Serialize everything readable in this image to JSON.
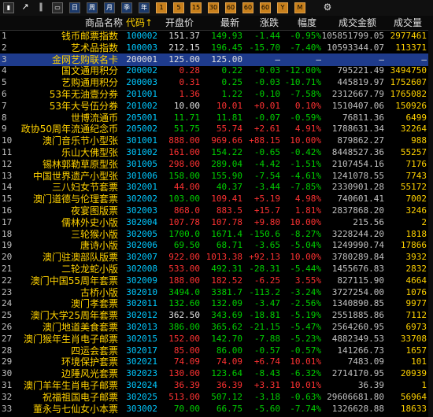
{
  "toolbar": {
    "buttons": [
      {
        "name": "bar-chart-icon",
        "label": "▮",
        "style": "square"
      },
      {
        "name": "line-chart-icon",
        "label": "↗",
        "style": "chart"
      },
      {
        "name": "tick-chart-icon",
        "label": "∥",
        "style": "chart"
      },
      {
        "name": "screen-icon",
        "label": "▭",
        "style": "square"
      },
      {
        "name": "period-day-button",
        "label": "日",
        "style": "blue"
      },
      {
        "name": "period-week-button",
        "label": "周",
        "style": "blue"
      },
      {
        "name": "period-month-button",
        "label": "月",
        "style": "blue"
      },
      {
        "name": "period-quarter-button",
        "label": "季",
        "style": "blue"
      },
      {
        "name": "period-year-button",
        "label": "年",
        "style": "blue"
      },
      {
        "name": "period-1min-button",
        "label": "1",
        "style": "orange"
      },
      {
        "name": "period-5min-button",
        "label": "5",
        "style": "orange"
      },
      {
        "name": "period-15min-button",
        "label": "15",
        "style": "orange"
      },
      {
        "name": "period-30min-button",
        "label": "30",
        "style": "orange"
      },
      {
        "name": "period-60min-button",
        "label": "60",
        "style": "orange"
      },
      {
        "name": "period-60min-button-2",
        "label": "60",
        "style": "orange"
      },
      {
        "name": "period-60min-button-3",
        "label": "60",
        "style": "orange"
      },
      {
        "name": "period-y-button",
        "label": "Y",
        "style": "orange"
      },
      {
        "name": "period-m-button",
        "label": "M",
        "style": "orange"
      },
      {
        "name": "settings-gear-icon",
        "label": "⚙",
        "style": "gear"
      }
    ]
  },
  "header": {
    "name": "商品名称",
    "code": "代码↑",
    "open": "开盘价",
    "last": "最新",
    "chg": "涨跌",
    "pct": "幅度",
    "amount": "成交金额",
    "volume": "成交量"
  },
  "rows": [
    {
      "idx": "1",
      "name": "钱币邮票指数",
      "code": "100002",
      "open": "151.37",
      "last": "149.93",
      "chg": "-1.44",
      "pct": "-0.95%",
      "amount": "105851799.05",
      "volume": "2977461",
      "openC": "white",
      "lastC": "green",
      "chgC": "green"
    },
    {
      "idx": "2",
      "name": "艺术品指数",
      "code": "100003",
      "open": "212.15",
      "last": "196.45",
      "chg": "-15.70",
      "pct": "-7.40%",
      "amount": "10593344.07",
      "volume": "113371",
      "openC": "white",
      "lastC": "green",
      "chgC": "green"
    },
    {
      "idx": "3",
      "name": "金网艺购联名卡",
      "code": "200001",
      "open": "125.00",
      "last": "125.00",
      "chg": "—",
      "pct": "—",
      "amount": "—",
      "volume": "—",
      "openC": "white",
      "lastC": "white",
      "chgC": "white",
      "selected": true
    },
    {
      "idx": "4",
      "name": "国文通用积分",
      "code": "200002",
      "open": "0.28",
      "last": "0.22",
      "chg": "-0.03",
      "pct": "-12.00%",
      "amount": "795221.49",
      "volume": "3494750",
      "openC": "red",
      "lastC": "green",
      "chgC": "green"
    },
    {
      "idx": "5",
      "name": "艺购通用积分",
      "code": "200003",
      "open": "0.31",
      "last": "0.25",
      "chg": "-0.03",
      "pct": "-10.71%",
      "amount": "445819.97",
      "volume": "1752607",
      "openC": "red",
      "lastC": "green",
      "chgC": "green"
    },
    {
      "idx": "6",
      "name": "53年无油壹分券",
      "code": "201001",
      "open": "1.36",
      "last": "1.22",
      "chg": "-0.10",
      "pct": "-7.58%",
      "amount": "2312667.79",
      "volume": "1765082",
      "openC": "red",
      "lastC": "green",
      "chgC": "green"
    },
    {
      "idx": "7",
      "name": "53年大号伍分券",
      "code": "201002",
      "open": "10.00",
      "last": "10.01",
      "chg": "+0.01",
      "pct": "0.10%",
      "amount": "1510407.06",
      "volume": "150926",
      "openC": "white",
      "lastC": "red",
      "chgC": "red"
    },
    {
      "idx": "8",
      "name": "世博流通币",
      "code": "205001",
      "open": "11.71",
      "last": "11.81",
      "chg": "-0.07",
      "pct": "-0.59%",
      "amount": "76811.36",
      "volume": "6499",
      "openC": "green",
      "lastC": "green",
      "chgC": "green"
    },
    {
      "idx": "9",
      "name": "政协50周年流通纪念币",
      "code": "205002",
      "open": "51.75",
      "last": "55.74",
      "chg": "+2.61",
      "pct": "4.91%",
      "amount": "1788631.34",
      "volume": "32264",
      "openC": "green",
      "lastC": "red",
      "chgC": "red"
    },
    {
      "idx": "10",
      "name": "澳门音乐节小型张",
      "code": "301001",
      "open": "888.00",
      "last": "969.66",
      "chg": "+88.15",
      "pct": "10.00%",
      "amount": "879862.27",
      "volume": "988",
      "openC": "red",
      "lastC": "red",
      "chgC": "red"
    },
    {
      "idx": "11",
      "name": "乐山大佛型张",
      "code": "301002",
      "open": "161.00",
      "last": "154.22",
      "chg": "-0.65",
      "pct": "-0.42%",
      "amount": "8448527.36",
      "volume": "55257",
      "openC": "red",
      "lastC": "green",
      "chgC": "green"
    },
    {
      "idx": "12",
      "name": "锡林郭勒草原型张",
      "code": "301005",
      "open": "298.00",
      "last": "289.04",
      "chg": "-4.42",
      "pct": "-1.51%",
      "amount": "2107454.16",
      "volume": "7176",
      "openC": "red",
      "lastC": "green",
      "chgC": "green"
    },
    {
      "idx": "13",
      "name": "中国世界遗产小型张",
      "code": "301006",
      "open": "158.00",
      "last": "155.90",
      "chg": "-7.54",
      "pct": "-4.61%",
      "amount": "1241078.55",
      "volume": "7743",
      "openC": "green",
      "lastC": "green",
      "chgC": "green"
    },
    {
      "idx": "14",
      "name": "三八妇女节套票",
      "code": "302001",
      "open": "44.00",
      "last": "40.37",
      "chg": "-3.44",
      "pct": "-7.85%",
      "amount": "2330901.28",
      "volume": "55172",
      "openC": "red",
      "lastC": "green",
      "chgC": "green"
    },
    {
      "idx": "15",
      "name": "澳门道德与伦理套票",
      "code": "302002",
      "open": "103.00",
      "last": "109.41",
      "chg": "+5.19",
      "pct": "4.98%",
      "amount": "740601.41",
      "volume": "7002",
      "openC": "green",
      "lastC": "red",
      "chgC": "red"
    },
    {
      "idx": "16",
      "name": "夜宴图版票",
      "code": "302003",
      "open": "868.0",
      "last": "883.5",
      "chg": "+15.7",
      "pct": "1.81%",
      "amount": "2837868.20",
      "volume": "3246",
      "openC": "red",
      "lastC": "red",
      "chgC": "red"
    },
    {
      "idx": "17",
      "name": "儒林外史小版",
      "code": "302004",
      "open": "107.78",
      "last": "107.78",
      "chg": "+9.80",
      "pct": "10.00%",
      "amount": "215.56",
      "volume": "2",
      "openC": "red",
      "lastC": "red",
      "chgC": "red"
    },
    {
      "idx": "18",
      "name": "三轮猴小版",
      "code": "302005",
      "open": "1700.0",
      "last": "1671.4",
      "chg": "-150.6",
      "pct": "-8.27%",
      "amount": "3228244.20",
      "volume": "1818",
      "openC": "green",
      "lastC": "green",
      "chgC": "green"
    },
    {
      "idx": "19",
      "name": "唐诗小版",
      "code": "302006",
      "open": "69.50",
      "last": "68.71",
      "chg": "-3.65",
      "pct": "-5.04%",
      "amount": "1249990.74",
      "volume": "17866",
      "openC": "green",
      "lastC": "green",
      "chgC": "green"
    },
    {
      "idx": "20",
      "name": "澳门驻澳部队版票",
      "code": "302007",
      "open": "922.00",
      "last": "1013.38",
      "chg": "+92.13",
      "pct": "10.00%",
      "amount": "3780289.84",
      "volume": "3932",
      "openC": "red",
      "lastC": "red",
      "chgC": "red"
    },
    {
      "idx": "21",
      "name": "二轮龙蛇小版",
      "code": "302008",
      "open": "533.00",
      "last": "492.31",
      "chg": "-28.31",
      "pct": "-5.44%",
      "amount": "1455676.83",
      "volume": "2832",
      "openC": "red",
      "lastC": "green",
      "chgC": "green"
    },
    {
      "idx": "22",
      "name": "澳门中国55周年套票",
      "code": "302009",
      "open": "188.00",
      "last": "182.52",
      "chg": "-6.25",
      "pct": "3.55%",
      "amount": "827115.90",
      "volume": "4664",
      "openC": "red",
      "lastC": "red",
      "chgC": "red"
    },
    {
      "idx": "23",
      "name": "古桥小版",
      "code": "302010",
      "open": "3494.0",
      "last": "3381.7",
      "chg": "-113.2",
      "pct": "-3.24%",
      "amount": "3727254.00",
      "volume": "1076",
      "openC": "green",
      "lastC": "green",
      "chgC": "green"
    },
    {
      "idx": "24",
      "name": "澳门孝套票",
      "code": "302011",
      "open": "132.60",
      "last": "132.09",
      "chg": "-3.47",
      "pct": "-2.56%",
      "amount": "1340890.85",
      "volume": "9977",
      "openC": "green",
      "lastC": "green",
      "chgC": "green"
    },
    {
      "idx": "25",
      "name": "澳门大学25周年套票",
      "code": "302012",
      "open": "362.50",
      "last": "343.69",
      "chg": "-18.81",
      "pct": "-5.19%",
      "amount": "2551885.86",
      "volume": "7112",
      "openC": "white",
      "lastC": "green",
      "chgC": "green"
    },
    {
      "idx": "26",
      "name": "澳门地道美食套票",
      "code": "302013",
      "open": "386.00",
      "last": "365.62",
      "chg": "-21.15",
      "pct": "-5.47%",
      "amount": "2564260.95",
      "volume": "6973",
      "openC": "green",
      "lastC": "green",
      "chgC": "green"
    },
    {
      "idx": "27",
      "name": "澳门猴年生肖电子邮票",
      "code": "302015",
      "open": "152.00",
      "last": "142.70",
      "chg": "-7.88",
      "pct": "-5.23%",
      "amount": "4882349.53",
      "volume": "33708",
      "openC": "red",
      "lastC": "green",
      "chgC": "green"
    },
    {
      "idx": "28",
      "name": "四运会套票",
      "code": "302017",
      "open": "85.00",
      "last": "86.00",
      "chg": "-0.57",
      "pct": "-0.57%",
      "amount": "141266.73",
      "volume": "1657",
      "openC": "red",
      "lastC": "green",
      "chgC": "green"
    },
    {
      "idx": "29",
      "name": "环境保护套票",
      "code": "302021",
      "open": "74.09",
      "last": "74.09",
      "chg": "+6.74",
      "pct": "10.01%",
      "amount": "7483.09",
      "volume": "101",
      "openC": "red",
      "lastC": "red",
      "chgC": "red"
    },
    {
      "idx": "30",
      "name": "边陲风光套票",
      "code": "302023",
      "open": "130.00",
      "last": "123.64",
      "chg": "-8.43",
      "pct": "-6.32%",
      "amount": "2714170.95",
      "volume": "20939",
      "openC": "red",
      "lastC": "green",
      "chgC": "green"
    },
    {
      "idx": "31",
      "name": "澳门羊年生肖电子邮票",
      "code": "302024",
      "open": "36.39",
      "last": "36.39",
      "chg": "+3.31",
      "pct": "10.01%",
      "amount": "36.39",
      "volume": "1",
      "openC": "red",
      "lastC": "red",
      "chgC": "red"
    },
    {
      "idx": "32",
      "name": "祝福祖国电子邮票",
      "code": "302025",
      "open": "513.00",
      "last": "507.12",
      "chg": "-3.18",
      "pct": "-0.63%",
      "amount": "29606681.80",
      "volume": "56964",
      "openC": "red",
      "lastC": "green",
      "chgC": "green"
    },
    {
      "idx": "33",
      "name": "董永与七仙女小本票",
      "code": "303002",
      "open": "70.00",
      "last": "66.75",
      "chg": "-5.60",
      "pct": "-7.74%",
      "amount": "1326628.88",
      "volume": "18633",
      "openC": "green",
      "lastC": "green",
      "chgC": "green"
    }
  ]
}
